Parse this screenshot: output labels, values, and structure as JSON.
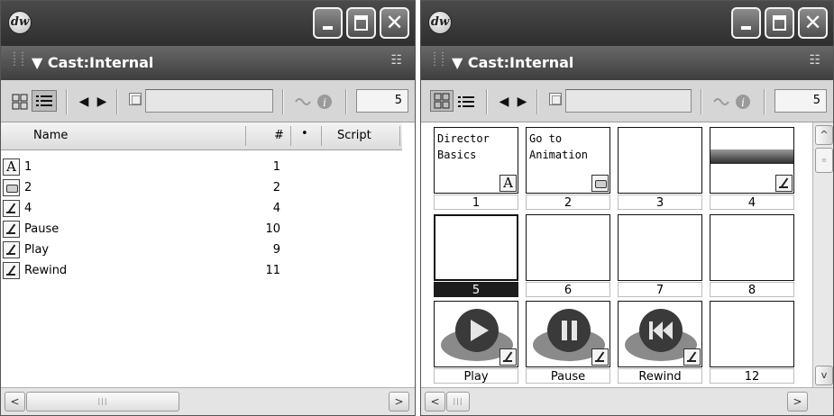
{
  "left_window": {
    "cast_title": "Cast:Internal",
    "member_number": "5",
    "columns": {
      "name": "Name",
      "number": "#",
      "dot": "•",
      "script": "Script"
    },
    "rows": [
      {
        "type": "text",
        "name": "1",
        "number": "1"
      },
      {
        "type": "button",
        "name": "2",
        "number": "2"
      },
      {
        "type": "paint",
        "name": "4",
        "number": "4"
      },
      {
        "type": "paint",
        "name": "Pause",
        "number": "10"
      },
      {
        "type": "paint",
        "name": "Play",
        "number": "9"
      },
      {
        "type": "paint",
        "name": "Rewind",
        "number": "11"
      }
    ]
  },
  "right_window": {
    "cast_title": "Cast:Internal",
    "member_number": "5",
    "cells": [
      {
        "label": "1",
        "text": "Director Basics",
        "badge": "text"
      },
      {
        "label": "2",
        "text": "Go to Animation",
        "badge": "button"
      },
      {
        "label": "3",
        "text": "",
        "badge": ""
      },
      {
        "label": "4",
        "text": "",
        "badge": "paint"
      },
      {
        "label": "5",
        "text": "",
        "badge": "",
        "selected": true
      },
      {
        "label": "6",
        "text": "",
        "badge": ""
      },
      {
        "label": "7",
        "text": "",
        "badge": ""
      },
      {
        "label": "8",
        "text": "",
        "badge": ""
      },
      {
        "label": "Play",
        "text": "",
        "badge": "paint"
      },
      {
        "label": "Pause",
        "text": "",
        "badge": "paint"
      },
      {
        "label": "Rewind",
        "text": "",
        "badge": "paint"
      },
      {
        "label": "12",
        "text": "",
        "badge": ""
      }
    ]
  },
  "icons": {
    "app_logo": "dw",
    "options": "☷",
    "prev": "◀",
    "next": "▶",
    "text_badge": "A",
    "scroll_left": "<",
    "scroll_right": ">",
    "scroll_up": "^",
    "scroll_down": "v",
    "close": "✕",
    "grip": "⋮",
    "triangle": "▼"
  },
  "colors": {
    "titlebar": "#2e2e2e",
    "selected_label": "#1c1c1c"
  }
}
